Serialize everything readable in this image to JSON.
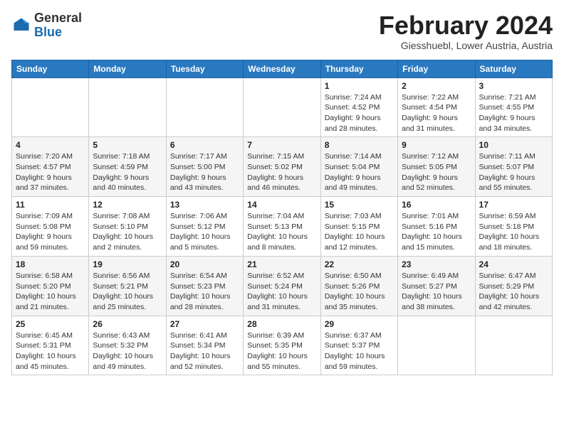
{
  "header": {
    "logo_general": "General",
    "logo_blue": "Blue",
    "month_year": "February 2024",
    "location": "Giesshuebl, Lower Austria, Austria"
  },
  "days_of_week": [
    "Sunday",
    "Monday",
    "Tuesday",
    "Wednesday",
    "Thursday",
    "Friday",
    "Saturday"
  ],
  "weeks": [
    [
      {
        "num": "",
        "info": ""
      },
      {
        "num": "",
        "info": ""
      },
      {
        "num": "",
        "info": ""
      },
      {
        "num": "",
        "info": ""
      },
      {
        "num": "1",
        "info": "Sunrise: 7:24 AM\nSunset: 4:52 PM\nDaylight: 9 hours\nand 28 minutes."
      },
      {
        "num": "2",
        "info": "Sunrise: 7:22 AM\nSunset: 4:54 PM\nDaylight: 9 hours\nand 31 minutes."
      },
      {
        "num": "3",
        "info": "Sunrise: 7:21 AM\nSunset: 4:55 PM\nDaylight: 9 hours\nand 34 minutes."
      }
    ],
    [
      {
        "num": "4",
        "info": "Sunrise: 7:20 AM\nSunset: 4:57 PM\nDaylight: 9 hours\nand 37 minutes."
      },
      {
        "num": "5",
        "info": "Sunrise: 7:18 AM\nSunset: 4:59 PM\nDaylight: 9 hours\nand 40 minutes."
      },
      {
        "num": "6",
        "info": "Sunrise: 7:17 AM\nSunset: 5:00 PM\nDaylight: 9 hours\nand 43 minutes."
      },
      {
        "num": "7",
        "info": "Sunrise: 7:15 AM\nSunset: 5:02 PM\nDaylight: 9 hours\nand 46 minutes."
      },
      {
        "num": "8",
        "info": "Sunrise: 7:14 AM\nSunset: 5:04 PM\nDaylight: 9 hours\nand 49 minutes."
      },
      {
        "num": "9",
        "info": "Sunrise: 7:12 AM\nSunset: 5:05 PM\nDaylight: 9 hours\nand 52 minutes."
      },
      {
        "num": "10",
        "info": "Sunrise: 7:11 AM\nSunset: 5:07 PM\nDaylight: 9 hours\nand 55 minutes."
      }
    ],
    [
      {
        "num": "11",
        "info": "Sunrise: 7:09 AM\nSunset: 5:08 PM\nDaylight: 9 hours\nand 59 minutes."
      },
      {
        "num": "12",
        "info": "Sunrise: 7:08 AM\nSunset: 5:10 PM\nDaylight: 10 hours\nand 2 minutes."
      },
      {
        "num": "13",
        "info": "Sunrise: 7:06 AM\nSunset: 5:12 PM\nDaylight: 10 hours\nand 5 minutes."
      },
      {
        "num": "14",
        "info": "Sunrise: 7:04 AM\nSunset: 5:13 PM\nDaylight: 10 hours\nand 8 minutes."
      },
      {
        "num": "15",
        "info": "Sunrise: 7:03 AM\nSunset: 5:15 PM\nDaylight: 10 hours\nand 12 minutes."
      },
      {
        "num": "16",
        "info": "Sunrise: 7:01 AM\nSunset: 5:16 PM\nDaylight: 10 hours\nand 15 minutes."
      },
      {
        "num": "17",
        "info": "Sunrise: 6:59 AM\nSunset: 5:18 PM\nDaylight: 10 hours\nand 18 minutes."
      }
    ],
    [
      {
        "num": "18",
        "info": "Sunrise: 6:58 AM\nSunset: 5:20 PM\nDaylight: 10 hours\nand 21 minutes."
      },
      {
        "num": "19",
        "info": "Sunrise: 6:56 AM\nSunset: 5:21 PM\nDaylight: 10 hours\nand 25 minutes."
      },
      {
        "num": "20",
        "info": "Sunrise: 6:54 AM\nSunset: 5:23 PM\nDaylight: 10 hours\nand 28 minutes."
      },
      {
        "num": "21",
        "info": "Sunrise: 6:52 AM\nSunset: 5:24 PM\nDaylight: 10 hours\nand 31 minutes."
      },
      {
        "num": "22",
        "info": "Sunrise: 6:50 AM\nSunset: 5:26 PM\nDaylight: 10 hours\nand 35 minutes."
      },
      {
        "num": "23",
        "info": "Sunrise: 6:49 AM\nSunset: 5:27 PM\nDaylight: 10 hours\nand 38 minutes."
      },
      {
        "num": "24",
        "info": "Sunrise: 6:47 AM\nSunset: 5:29 PM\nDaylight: 10 hours\nand 42 minutes."
      }
    ],
    [
      {
        "num": "25",
        "info": "Sunrise: 6:45 AM\nSunset: 5:31 PM\nDaylight: 10 hours\nand 45 minutes."
      },
      {
        "num": "26",
        "info": "Sunrise: 6:43 AM\nSunset: 5:32 PM\nDaylight: 10 hours\nand 49 minutes."
      },
      {
        "num": "27",
        "info": "Sunrise: 6:41 AM\nSunset: 5:34 PM\nDaylight: 10 hours\nand 52 minutes."
      },
      {
        "num": "28",
        "info": "Sunrise: 6:39 AM\nSunset: 5:35 PM\nDaylight: 10 hours\nand 55 minutes."
      },
      {
        "num": "29",
        "info": "Sunrise: 6:37 AM\nSunset: 5:37 PM\nDaylight: 10 hours\nand 59 minutes."
      },
      {
        "num": "",
        "info": ""
      },
      {
        "num": "",
        "info": ""
      }
    ]
  ]
}
